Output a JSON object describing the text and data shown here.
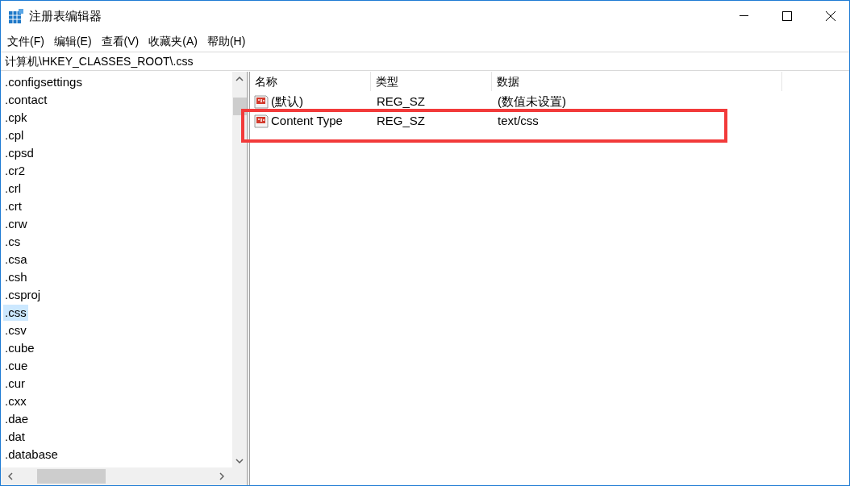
{
  "window": {
    "title": "注册表编辑器"
  },
  "menu": [
    "文件(F)",
    "编辑(E)",
    "查看(V)",
    "收藏夹(A)",
    "帮助(H)"
  ],
  "address": "计算机\\HKEY_CLASSES_ROOT\\.css",
  "tree": [
    {
      "label": ".configsettings",
      "selected": false
    },
    {
      "label": ".contact",
      "selected": false
    },
    {
      "label": ".cpk",
      "selected": false
    },
    {
      "label": ".cpl",
      "selected": false
    },
    {
      "label": ".cpsd",
      "selected": false
    },
    {
      "label": ".cr2",
      "selected": false
    },
    {
      "label": ".crl",
      "selected": false
    },
    {
      "label": ".crt",
      "selected": false
    },
    {
      "label": ".crw",
      "selected": false
    },
    {
      "label": ".cs",
      "selected": false
    },
    {
      "label": ".csa",
      "selected": false
    },
    {
      "label": ".csh",
      "selected": false
    },
    {
      "label": ".csproj",
      "selected": false
    },
    {
      "label": ".css",
      "selected": true
    },
    {
      "label": ".csv",
      "selected": false
    },
    {
      "label": ".cube",
      "selected": false
    },
    {
      "label": ".cue",
      "selected": false
    },
    {
      "label": ".cur",
      "selected": false
    },
    {
      "label": ".cxx",
      "selected": false
    },
    {
      "label": ".dae",
      "selected": false
    },
    {
      "label": ".dat",
      "selected": false
    },
    {
      "label": ".database",
      "selected": false
    }
  ],
  "table": {
    "columns": [
      "名称",
      "类型",
      "数据"
    ],
    "rows": [
      {
        "name": "(默认)",
        "type": "REG_SZ",
        "data": "(数值未设置)",
        "highlighted": false
      },
      {
        "name": "Content Type",
        "type": "REG_SZ",
        "data": "text/css",
        "highlighted": true
      }
    ]
  }
}
